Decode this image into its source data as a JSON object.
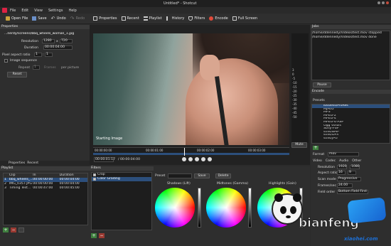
{
  "window": {
    "title": "Untitled* - Shotcut"
  },
  "menu": [
    "File",
    "Edit",
    "View",
    "Settings",
    "Help"
  ],
  "toolbar": [
    {
      "label": "Open File",
      "icon": "folder-icon"
    },
    {
      "label": "Save",
      "icon": "save-icon"
    },
    {
      "label": "Undo",
      "icon": "undo-icon"
    },
    {
      "label": "Redo",
      "icon": "redo-icon"
    },
    {
      "label": "Properties",
      "icon": "properties-icon"
    },
    {
      "label": "Recent",
      "icon": "recent-icon"
    },
    {
      "label": "Playlist",
      "icon": "playlist-icon"
    },
    {
      "label": "History",
      "icon": "history-icon"
    },
    {
      "label": "Filters",
      "icon": "filters-icon"
    },
    {
      "label": "Encode",
      "icon": "encode-icon"
    },
    {
      "label": "Full Screen",
      "icon": "fullscreen-icon"
    }
  ],
  "properties": {
    "header": "Properties",
    "file": "...nerdy/screens/bbq_wheels_woman_1.jpg",
    "resolution_label": "Resolution",
    "res_w": "1280",
    "res_x": "x",
    "res_h": "720",
    "duration_label": "Duration",
    "duration": "00:00:04:00",
    "aspect_label": "Pixel aspect ratio",
    "aspect_a": "1",
    "aspect_sep": ":",
    "aspect_b": "1",
    "image_seq": "Image sequence",
    "repeat_label": "Repeat",
    "repeat_value": "1",
    "frames_label": "Frames",
    "per_picture": "per picture",
    "reset": "Reset",
    "tabs": [
      "Properties",
      "Recent"
    ]
  },
  "playlist": {
    "header": "Playlist",
    "columns": [
      "",
      "Clip",
      "In",
      "Duration"
    ],
    "rows": [
      {
        "num": "1",
        "clip": "bbq_wheels_...",
        "in": "00:00:00:00",
        "dur": "00:00:04:00"
      },
      {
        "num": "2",
        "clip": "IMG_0357.JPG",
        "in": "00:00:00:00",
        "dur": "00:00:04:00"
      },
      {
        "num": "3",
        "clip": "Timing Test...",
        "in": "00:00:47:00",
        "dur": "00:00:45:00"
      }
    ]
  },
  "viewer": {
    "caption": "Starting Image",
    "timecode_left": "00:00:01:17",
    "timecode_right": "/ 00:00:04:00",
    "ruler": [
      "00:00:00:00",
      "00:00:01:00",
      "00:00:02:00",
      "00:00:03:00"
    ],
    "mute": "Mute",
    "meter_scale": [
      "3",
      "0",
      "-5",
      "-10",
      "-15",
      "-20",
      "-25",
      "-30",
      "-35",
      "-40",
      "-45",
      "-50"
    ]
  },
  "filters": {
    "header": "Filters",
    "items": [
      {
        "label": "Crop",
        "checked": true
      },
      {
        "label": "Color Grading",
        "checked": true
      }
    ],
    "preset_label": "Preset",
    "save": "Save",
    "delete": "Delete",
    "wheels": [
      "Shadows (Lift)",
      "Midtones (Gamma)",
      "Highlights (Gain)"
    ]
  },
  "jobs": {
    "header": "Jobs",
    "rows": [
      {
        "name": "/home/ddennedy/Videos/test.mov",
        "status": "stopped"
      },
      {
        "name": "/home/ddennedy/Videos/test.mov",
        "status": "done"
      }
    ],
    "pause": "Pause"
  },
  "encode": {
    "header": "Encode",
    "presets_label": "Presets",
    "presets": [
      "lossless/ProRes",
      "MJPEG",
      "MP3",
      "MPEG-2",
      "MPEG-4",
      "MPEG-4-ASP",
      "Ogg Vorbis",
      "Sony-PSP",
      "stills/BMP",
      "stills/DPX",
      "stills/JPG"
    ],
    "format_label": "Format",
    "format_value": "mov",
    "tabs": [
      "Video",
      "Codec",
      "Audio",
      "Other"
    ],
    "resolution_label": "Resolution",
    "res_w": "1920",
    "res_h": "1080",
    "aspect_label": "Aspect ratio",
    "aspect_a": "16",
    "aspect_b": "9",
    "scan_label": "Scan mode",
    "scan_value": "Progressive",
    "fps_label": "Frames/sec",
    "fps_value": "24.00",
    "field_label": "Field order",
    "field_value": "Bottom Field First"
  },
  "watermark": {
    "main": "bianfeng",
    "site": "xiaohei.com"
  }
}
